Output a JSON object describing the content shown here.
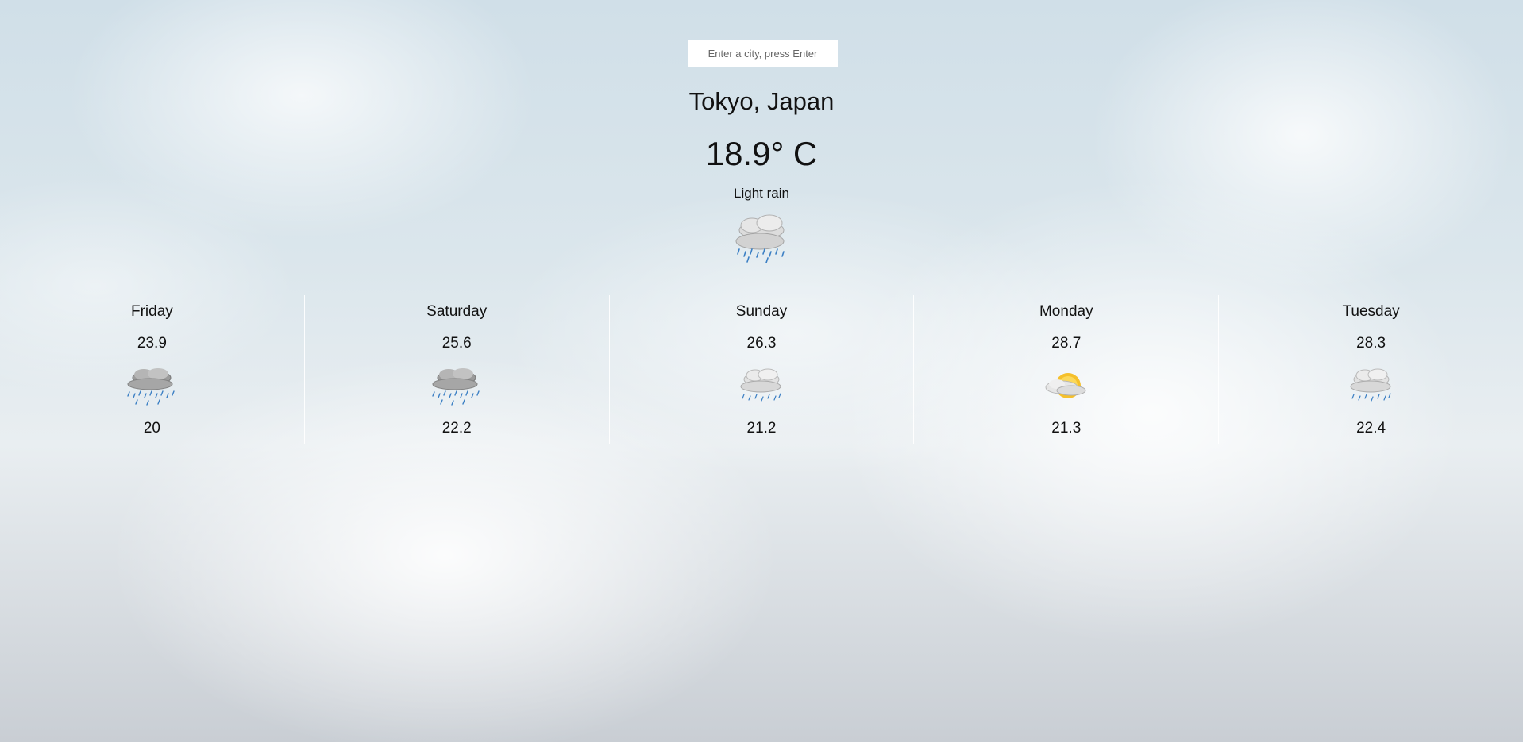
{
  "search": {
    "placeholder": "Enter a city, press Enter",
    "value": ""
  },
  "current": {
    "location": "Tokyo, Japan",
    "temperature": "18.9° C",
    "description": "Light rain",
    "icon": "light-rain-icon"
  },
  "forecast": [
    {
      "day": "Friday",
      "high": "23.9",
      "low": "20",
      "icon": "heavy-rain-icon"
    },
    {
      "day": "Saturday",
      "high": "25.6",
      "low": "22.2",
      "icon": "heavy-rain-icon"
    },
    {
      "day": "Sunday",
      "high": "26.3",
      "low": "21.2",
      "icon": "light-rain-icon"
    },
    {
      "day": "Monday",
      "high": "28.7",
      "low": "21.3",
      "icon": "partly-cloudy-icon"
    },
    {
      "day": "Tuesday",
      "high": "28.3",
      "low": "22.4",
      "icon": "light-rain-icon"
    }
  ],
  "colors": {
    "sun": "#f5c02b",
    "rain": "#3b7fc4",
    "cloud": "#c9c9c9"
  }
}
